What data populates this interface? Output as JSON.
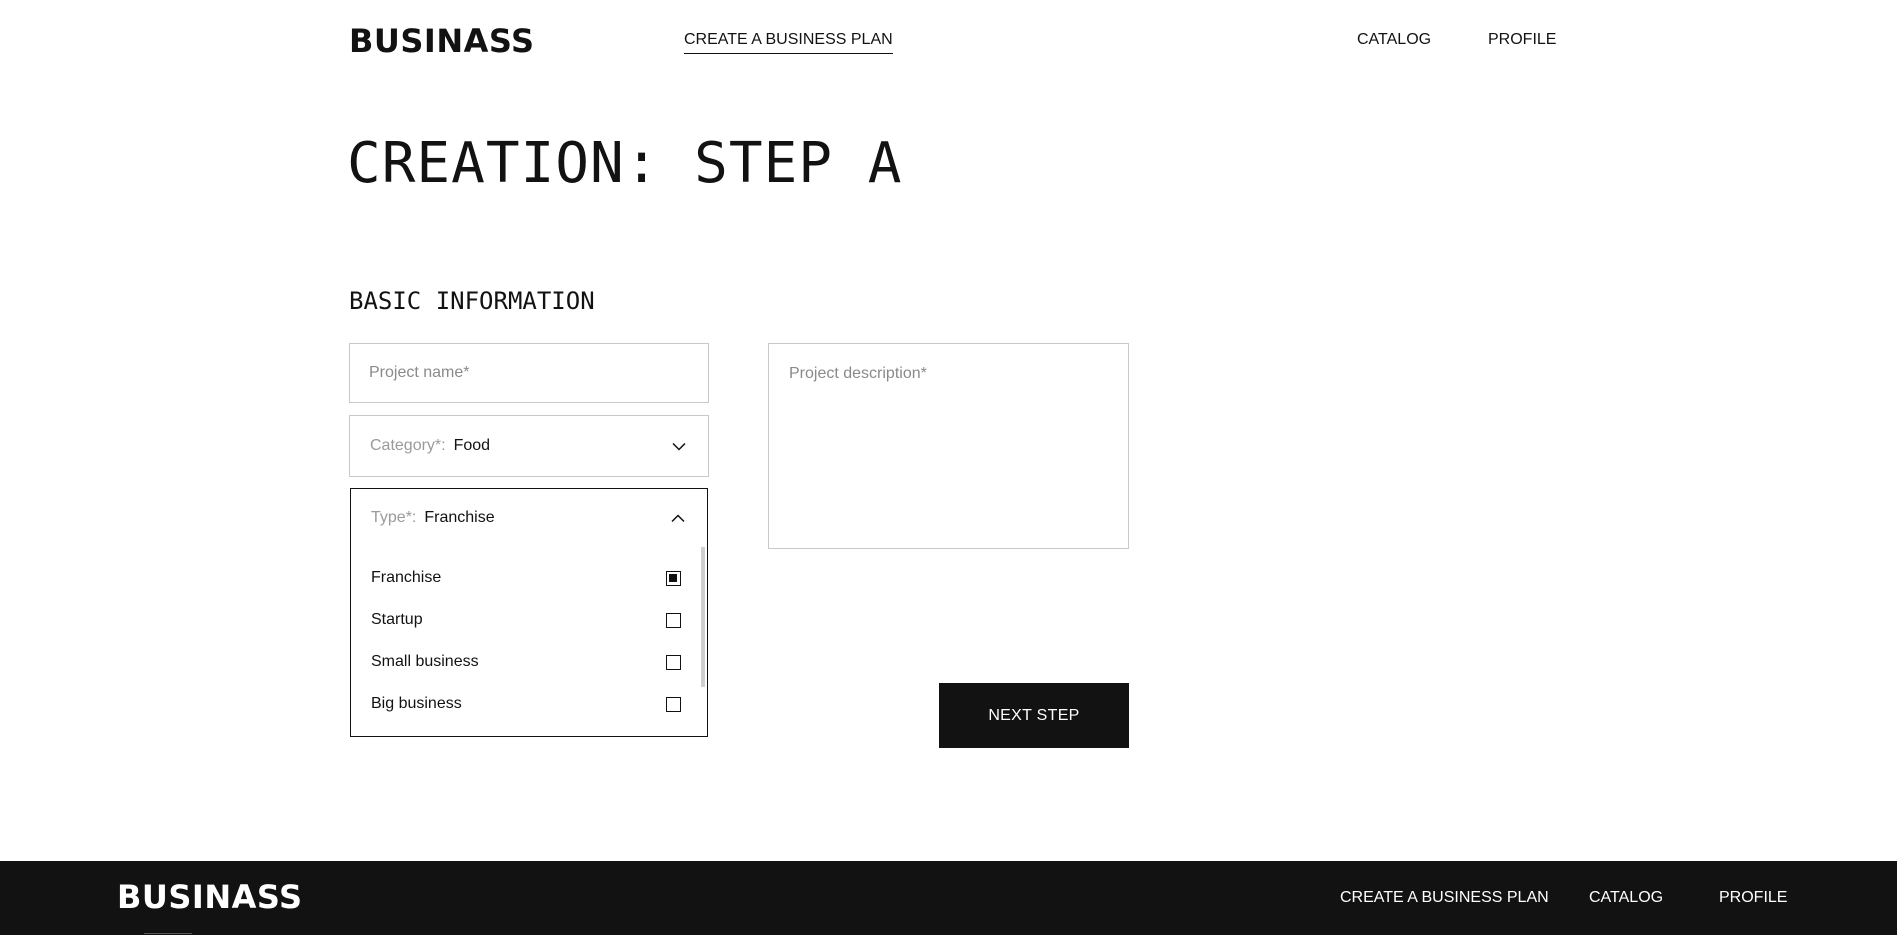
{
  "header": {
    "logo": "BUSINASS",
    "nav": {
      "create": "CREATE A BUSINESS PLAN",
      "catalog": "CATALOG",
      "profile": "PROFILE"
    }
  },
  "page_title": "CREATION: STEP A",
  "section_title": "BASIC INFORMATION",
  "form": {
    "project_name": {
      "placeholder": "Project name*",
      "value": ""
    },
    "category": {
      "label": "Category*:",
      "value": "Food"
    },
    "type": {
      "label": "Type*:",
      "value": "Franchise",
      "options": [
        {
          "label": "Franchise",
          "checked": true
        },
        {
          "label": "Startup",
          "checked": false
        },
        {
          "label": "Small business",
          "checked": false
        },
        {
          "label": "Big business",
          "checked": false
        }
      ]
    },
    "description": {
      "placeholder": "Project description*",
      "value": ""
    },
    "next_label": "NEXT STEP"
  },
  "footer": {
    "logo": "BUSINASS",
    "nav": {
      "create": "CREATE A BUSINESS PLAN",
      "catalog": "CATALOG",
      "profile": "PROFILE"
    }
  },
  "colors": {
    "primary": "#121212",
    "background": "#ffffff",
    "border": "#c9c9c9",
    "muted_text": "#8a8a8a"
  },
  "icons": {
    "category_chevron": "chevron-down-icon",
    "type_chevron": "chevron-up-icon"
  }
}
